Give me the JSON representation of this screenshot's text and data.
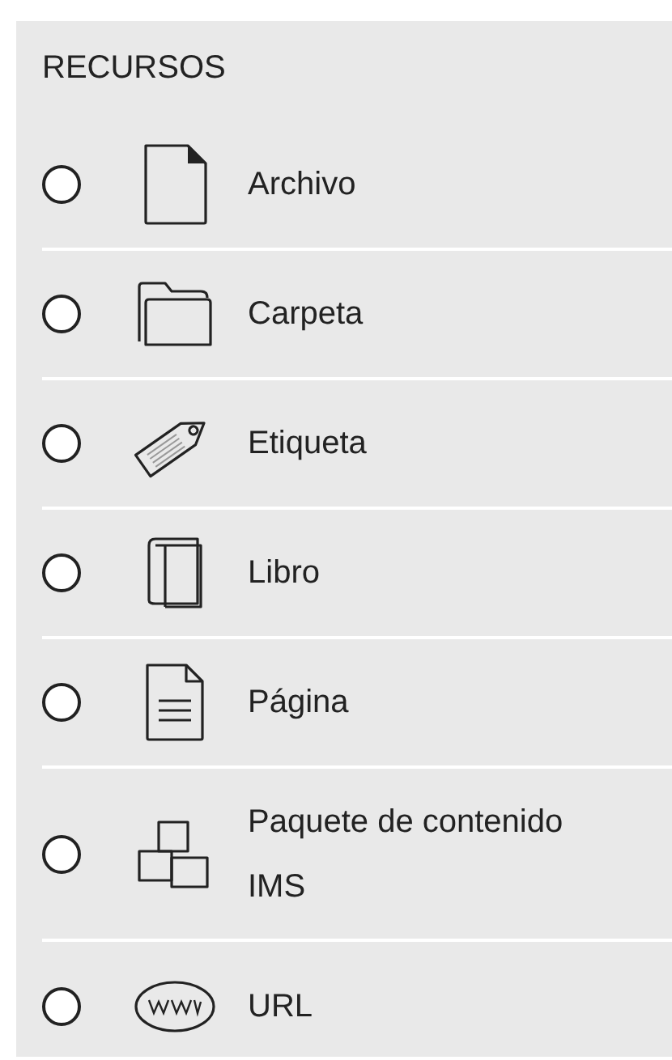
{
  "section": {
    "title": "RECURSOS"
  },
  "items": [
    {
      "label": "Archivo",
      "kind": "file",
      "selected": false
    },
    {
      "label": "Carpeta",
      "kind": "folder",
      "selected": false
    },
    {
      "label": "Etiqueta",
      "kind": "tag",
      "selected": false
    },
    {
      "label": "Libro",
      "kind": "book",
      "selected": false
    },
    {
      "label": "Página",
      "kind": "page",
      "selected": false
    },
    {
      "label": "Paquete de contenido IMS",
      "kind": "package",
      "selected": false
    },
    {
      "label": "URL",
      "kind": "url",
      "selected": false
    }
  ]
}
